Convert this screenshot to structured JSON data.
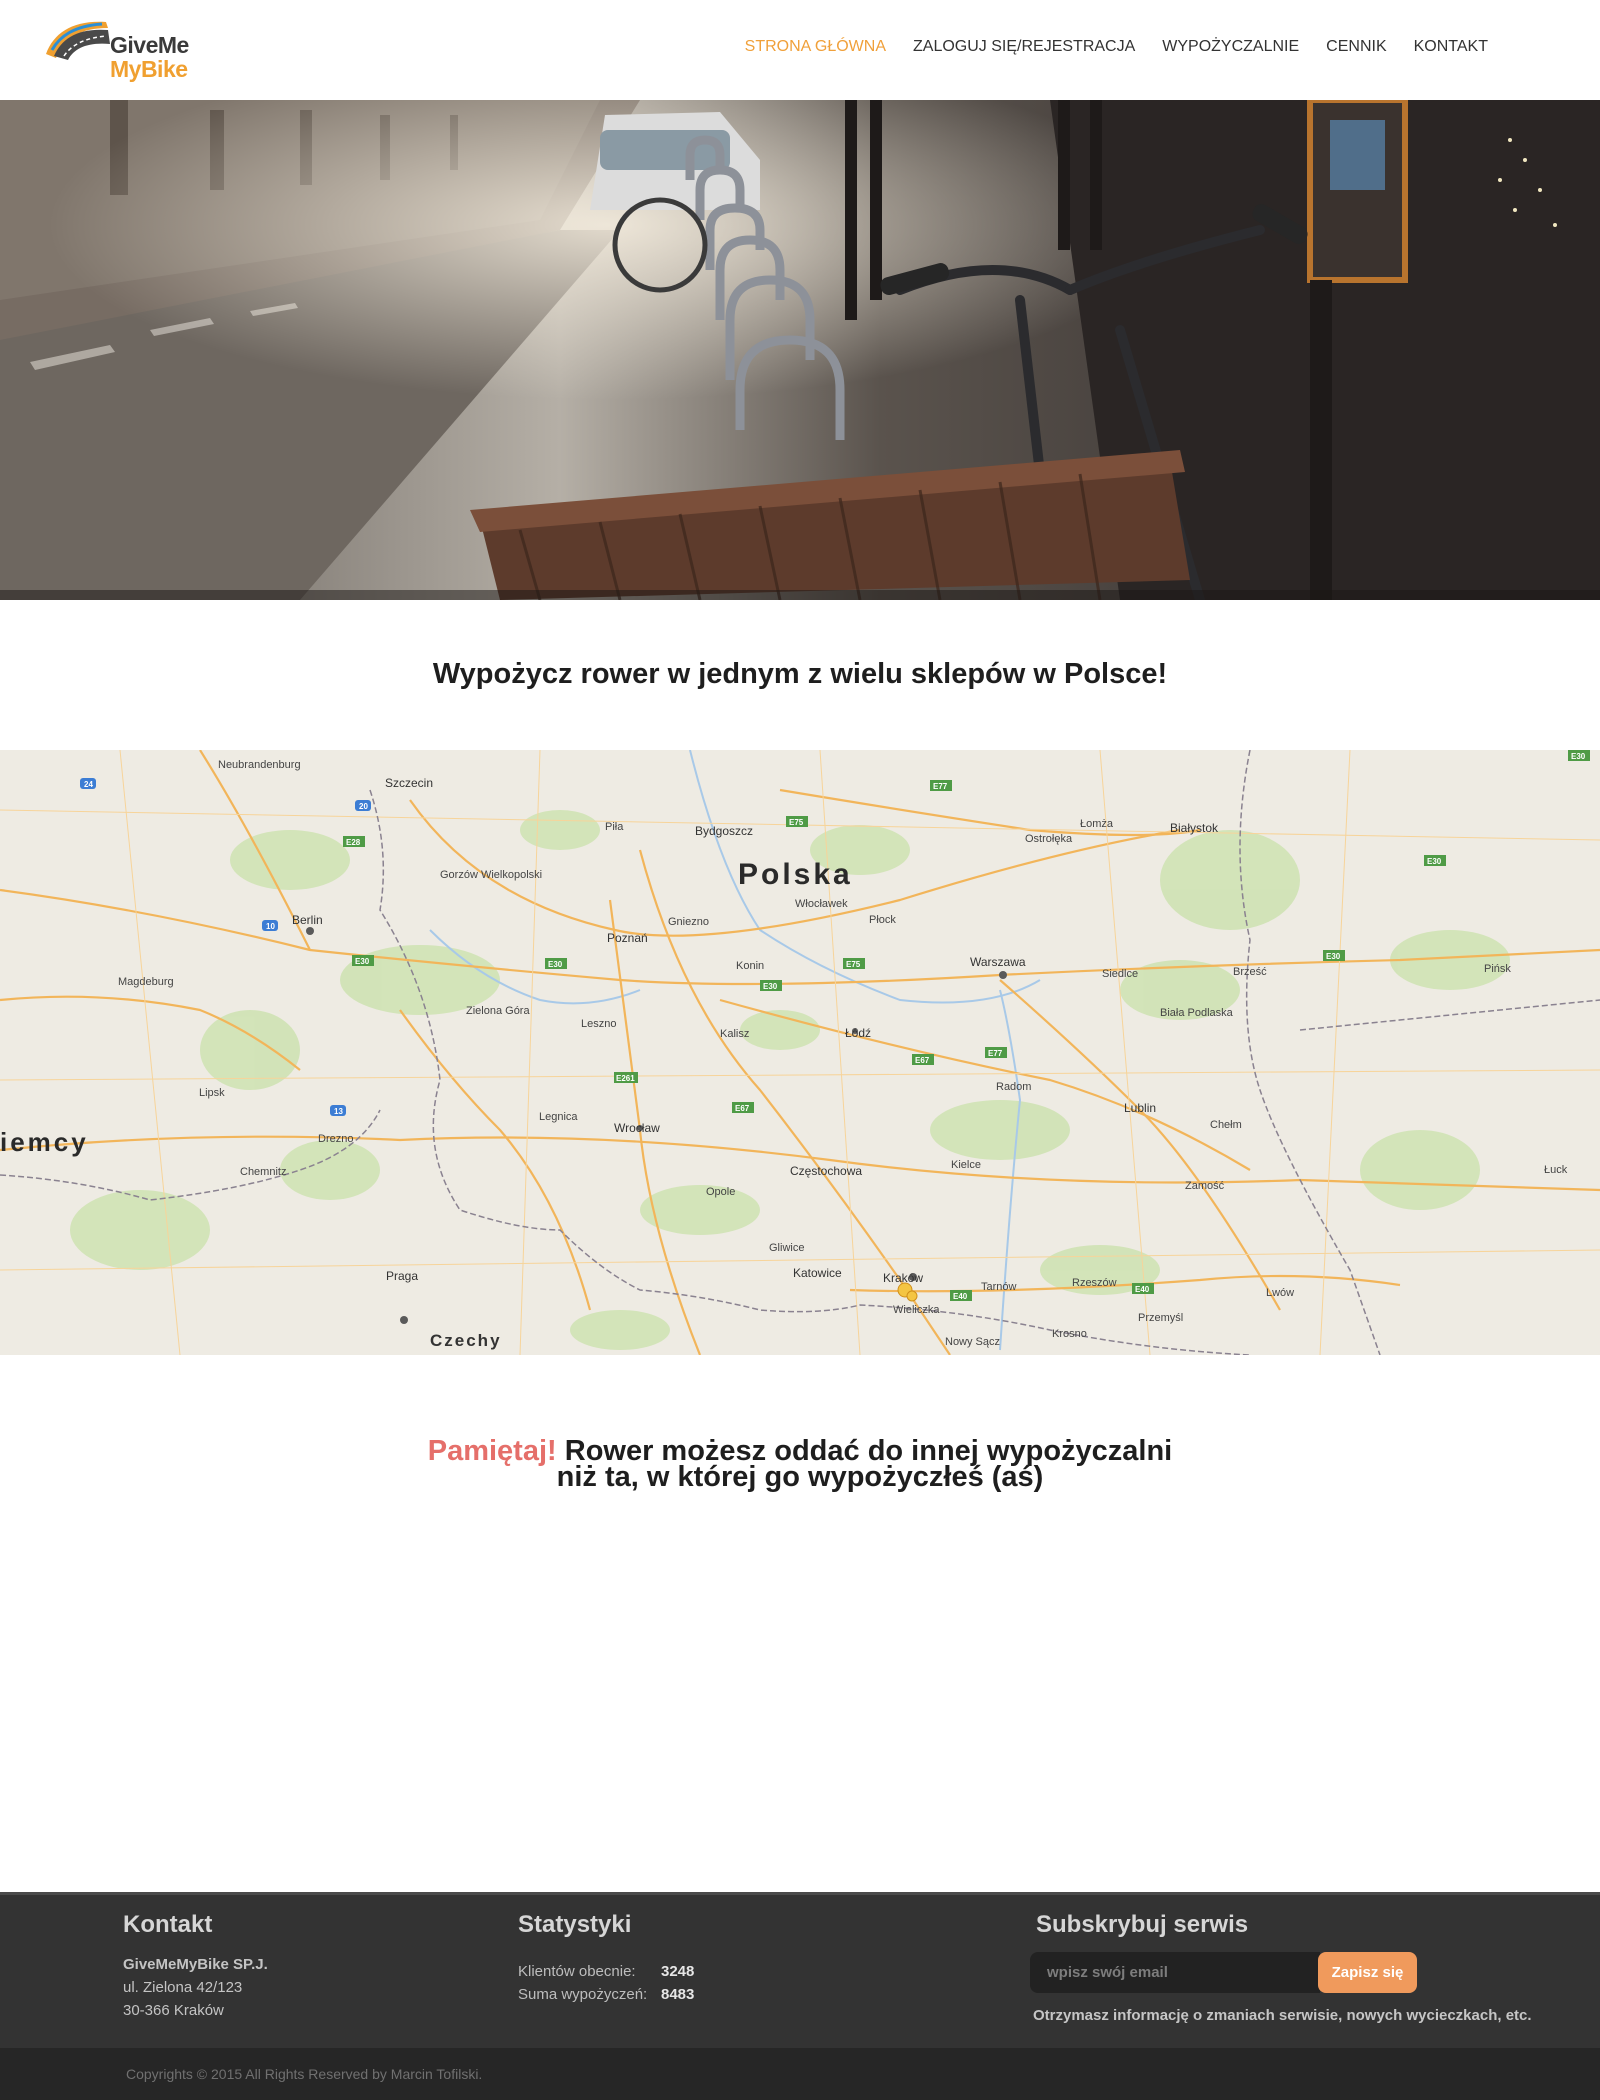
{
  "header": {
    "logo_line1": "GiveMe",
    "logo_line2": "MyBike",
    "nav": [
      {
        "label": "STRONA GŁÓWNA",
        "active": true
      },
      {
        "label": "ZALOGUJ SIĘ/REJESTRACJA",
        "active": false
      },
      {
        "label": "WYPOŻYCZALNIE",
        "active": false
      },
      {
        "label": "CENNIK",
        "active": false
      },
      {
        "label": "KONTAKT",
        "active": false
      }
    ]
  },
  "main": {
    "heading": "Wypożycz rower w jednym z wielu sklepów w Polsce!",
    "reminder_accent": "Pamiętaj!",
    "reminder_text": " Rower możesz oddać do innej wypożyczalni niż ta, w której go wypożyczłeś (aś)"
  },
  "map": {
    "country_label": "Polska",
    "labels": [
      {
        "text": "Szczecin"
      },
      {
        "text": "Bydgoszcz"
      },
      {
        "text": "Białystok"
      },
      {
        "text": "Poznań"
      },
      {
        "text": "Warszawa"
      },
      {
        "text": "Łódź"
      },
      {
        "text": "Wrocław"
      },
      {
        "text": "Lublin"
      },
      {
        "text": "Częstochowa"
      },
      {
        "text": "Katowice"
      },
      {
        "text": "Kraków"
      },
      {
        "text": "Berlin"
      },
      {
        "text": "Praga"
      },
      {
        "text": "Czechy"
      },
      {
        "text": "iemcy"
      },
      {
        "text": "Neubrandenburg"
      },
      {
        "text": "Gorzów Wielkopolski"
      },
      {
        "text": "Zielona Góra"
      },
      {
        "text": "Gniezno"
      },
      {
        "text": "Płock"
      },
      {
        "text": "Włocławek"
      },
      {
        "text": "Kielce"
      },
      {
        "text": "Radom"
      },
      {
        "text": "Rzeszów"
      },
      {
        "text": "Opole"
      },
      {
        "text": "Legnica"
      },
      {
        "text": "Lwów"
      },
      {
        "text": "Drezno"
      },
      {
        "text": "Lipsk"
      },
      {
        "text": "Magdeburg"
      },
      {
        "text": "Ostrołęka"
      },
      {
        "text": "Łomża"
      },
      {
        "text": "Siedlce"
      },
      {
        "text": "Biała Podlaska"
      },
      {
        "text": "Chełm"
      },
      {
        "text": "Zamość"
      },
      {
        "text": "Tarnów"
      },
      {
        "text": "Przemyśl"
      },
      {
        "text": "Krosno"
      },
      {
        "text": "Nowy Sącz"
      },
      {
        "text": "Gliwice"
      },
      {
        "text": "Wieliczka"
      },
      {
        "text": "Leszno"
      },
      {
        "text": "Kalisz"
      },
      {
        "text": "Konin"
      },
      {
        "text": "Piła"
      },
      {
        "text": "Chemnitz"
      },
      {
        "text": "Łuck"
      },
      {
        "text": "Pińsk"
      },
      {
        "text": "Brześć"
      }
    ]
  },
  "footer": {
    "contact": {
      "title": "Kontakt",
      "company": "GiveMeMyBike SP.J.",
      "street": "ul. Zielona 42/123",
      "city": "30-366 Kraków"
    },
    "stats": {
      "title": "Statystyki",
      "clients_label": "Klientów obecnie:",
      "clients_value": "3248",
      "rentals_label": "Suma wypożyczeń:",
      "rentals_value": "8483"
    },
    "subscribe": {
      "title": "Subskrybuj serwis",
      "placeholder": "wpisz swój email",
      "button": "Zapisz się",
      "note": "Otrzymasz informację o zmaniach serwisie, nowych wycieczkach, etc."
    },
    "copyright": "Copyrights © 2015 All Rights Reserved by Marcin Tofilski."
  },
  "colors": {
    "accent_orange": "#f0a03a",
    "accent_red": "#e56f6a",
    "footer_bg": "#333333",
    "button": "#f09a5c"
  }
}
